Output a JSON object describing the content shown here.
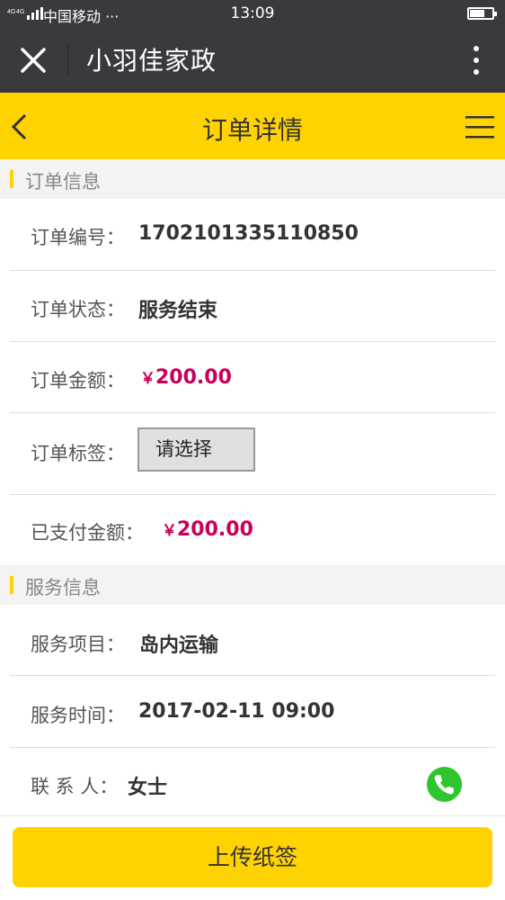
{
  "status_bar": {
    "network": "4G 4G",
    "carrier": "中国移动 ···",
    "time": "13:09",
    "icons": [
      "signal-icon",
      "battery-icon"
    ]
  },
  "wechat_bar": {
    "title": "小羽佳家政",
    "icons": [
      "close-icon",
      "more-vertical-icon"
    ]
  },
  "header": {
    "title": "订单详情",
    "icons": [
      "back-chevron-icon",
      "menu-icon"
    ],
    "color": "#ffd302"
  },
  "order_section": {
    "title": "订单信息",
    "rows": {
      "number": {
        "label": "订单编号：",
        "value": "1702101335110850"
      },
      "status": {
        "label": "订单状态：",
        "value": "服务结束"
      },
      "amount": {
        "label": "订单金额：",
        "currency": "￥",
        "value": "200.00"
      },
      "tag": {
        "label": "订单标签：",
        "select_value": "请选择"
      },
      "paid": {
        "label": "已支付金额：",
        "currency": "￥",
        "value": "200.00"
      }
    }
  },
  "service_section": {
    "title": "服务信息",
    "rows": {
      "item": {
        "label": "服务项目：",
        "value": "岛内运输"
      },
      "time": {
        "label": "服务时间：",
        "value": "2017-02-11 09:00"
      },
      "contact": {
        "label": "联 系 人：",
        "value": "女士",
        "icon": "phone-icon"
      }
    }
  },
  "footer": {
    "upload_label": "上传纸签"
  },
  "colors": {
    "accent": "#ffd302",
    "money": "#c8005a",
    "phone": "#2ec52e",
    "dark_bar": "#393a3f"
  }
}
